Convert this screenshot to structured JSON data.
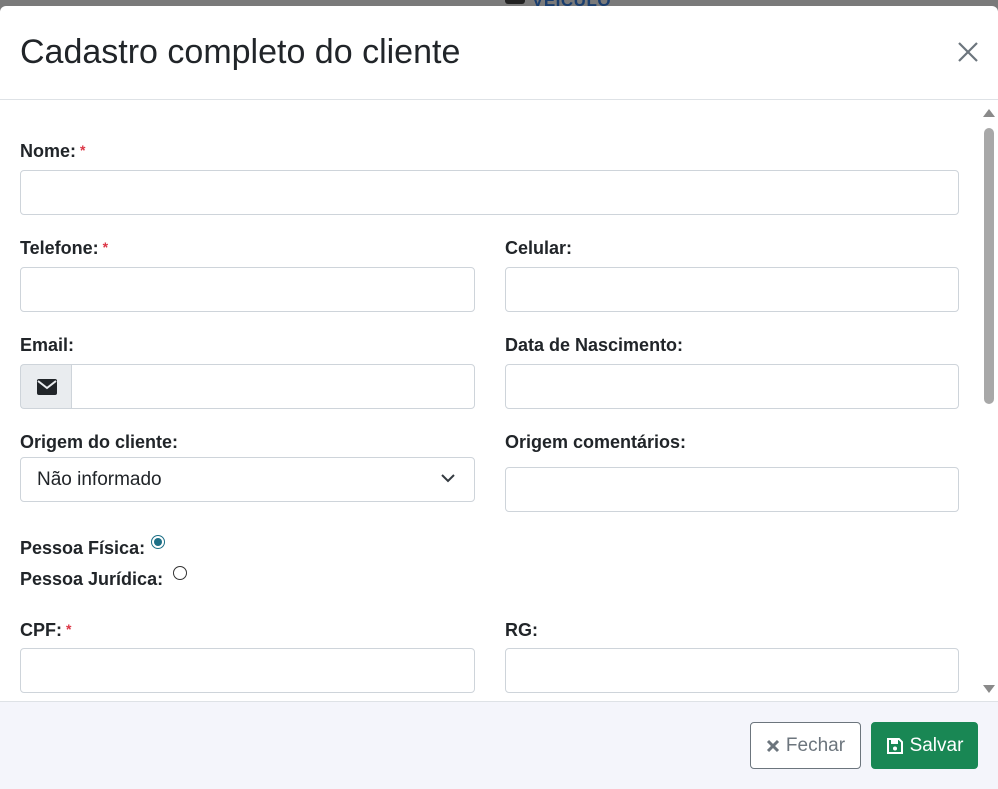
{
  "background": {
    "text": "VEÍCULO"
  },
  "modal": {
    "title": "Cadastro completo do cliente"
  },
  "form": {
    "nome_label": "Nome:",
    "telefone_label": "Telefone:",
    "celular_label": "Celular:",
    "email_label": "Email:",
    "nascimento_label": "Data de Nascimento:",
    "origem_label": "Origem do cliente:",
    "origem_value": "Não informado",
    "origem_comentarios_label": "Origem comentários:",
    "pf_label": "Pessoa Física:",
    "pj_label": "Pessoa Jurídica:",
    "cpf_label": "CPF:",
    "rg_label": "RG:",
    "required_mark": "*",
    "pessoa_selected": "Pessoa Física"
  },
  "footer": {
    "close_label": "Fechar",
    "save_label": "Salvar"
  },
  "colors": {
    "save": "#198754",
    "required": "#dc3545",
    "radio_checked": "#1d6f86"
  }
}
